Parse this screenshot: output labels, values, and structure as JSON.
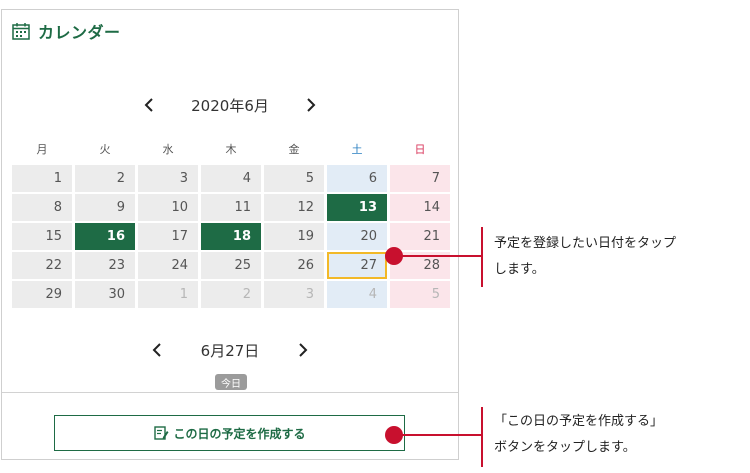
{
  "panel": {
    "title": "カレンダー",
    "icon": "calendar-icon"
  },
  "calendar": {
    "month_label": "2020年6月",
    "weekdays": [
      "月",
      "火",
      "水",
      "木",
      "金",
      "土",
      "日"
    ],
    "weeks": [
      [
        "1",
        "2",
        "3",
        "4",
        "5",
        "6",
        "7"
      ],
      [
        "8",
        "9",
        "10",
        "11",
        "12",
        "13",
        "14"
      ],
      [
        "15",
        "16",
        "17",
        "18",
        "19",
        "20",
        "21"
      ],
      [
        "22",
        "23",
        "24",
        "25",
        "26",
        "27",
        "28"
      ],
      [
        "29",
        "30",
        "1",
        "2",
        "3",
        "4",
        "5"
      ]
    ],
    "scheduled_days": [
      "13",
      "16",
      "18"
    ],
    "selected_day": "27"
  },
  "selected_date": {
    "label": "6月27日",
    "today_label": "今日"
  },
  "create_button": {
    "label": "この日の予定を作成する",
    "icon": "note-edit-icon"
  },
  "callouts": {
    "tap_date": [
      "予定を登録したい日付をタップ",
      "します。"
    ],
    "tap_button": [
      "「この日の予定を作成する」",
      "ボタンをタップします。"
    ]
  },
  "colors": {
    "brand_green": "#1e6b45",
    "saturday_blue": "#2a7fc1",
    "sunday_red": "#d9365b",
    "selected_border": "#f2b928",
    "callout_red": "#c8102e"
  }
}
